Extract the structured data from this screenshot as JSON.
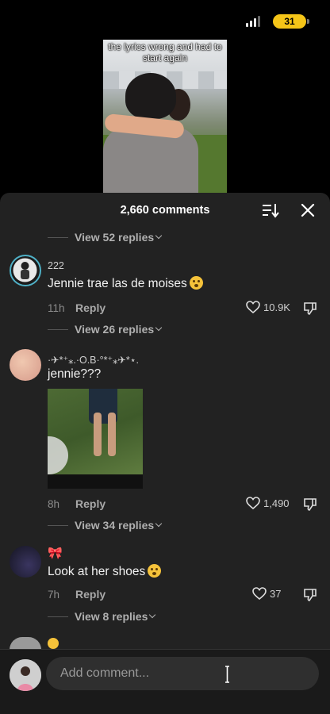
{
  "status": {
    "battery": "31"
  },
  "video": {
    "caption": "the lyrics wrong and had to start again"
  },
  "header": {
    "comment_count": "2,660 comments"
  },
  "replies_top": "View 52 replies",
  "comments": [
    {
      "username": "222",
      "text": "Jennie trae las de moises",
      "emoji": "loudly-crying-face",
      "time": "11h",
      "reply": "Reply",
      "likes": "10.9K",
      "view_replies": "View 26 replies"
    },
    {
      "username": "·✈︎*⁺⁎.·O.B·°*⁺⁎✈︎*⋆.",
      "text": "jennie???",
      "time": "8h",
      "reply": "Reply",
      "likes": "1,490",
      "view_replies": "View 34 replies"
    },
    {
      "username": "🎀",
      "text": "Look at her shoes",
      "emoji": "flushed-face",
      "time": "7h",
      "reply": "Reply",
      "likes": "37",
      "view_replies": "View 8 replies"
    }
  ],
  "input": {
    "placeholder": "Add comment..."
  },
  "colors": {
    "sheet_bg": "#222222",
    "battery": "#f5c518",
    "accent_text": "#b0b0b0"
  }
}
